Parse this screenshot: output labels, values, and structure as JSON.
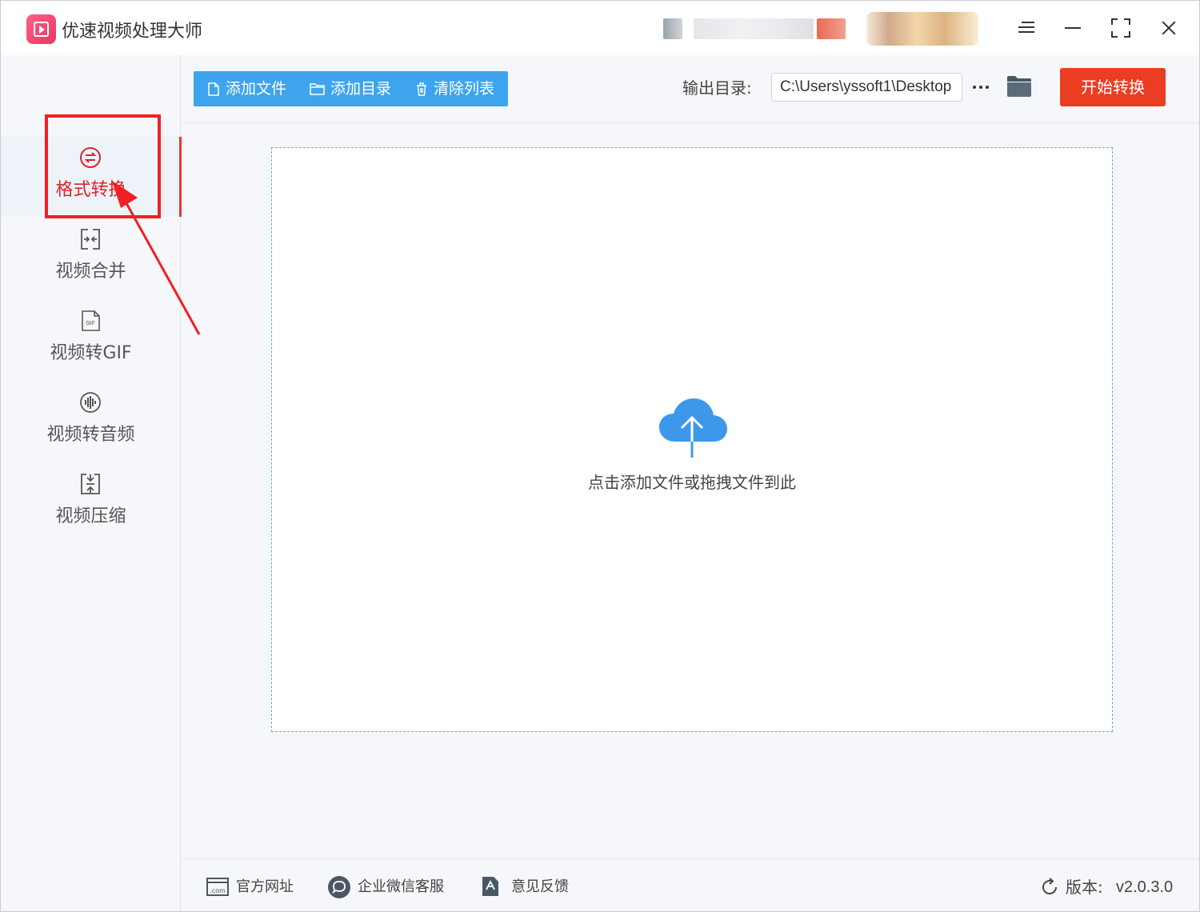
{
  "window": {
    "title": "优速视频处理大师"
  },
  "sidebar": {
    "items": [
      {
        "label": "格式转换",
        "icon": "format-convert-icon",
        "active": true
      },
      {
        "label": "视频合并",
        "icon": "video-merge-icon",
        "active": false
      },
      {
        "label": "视频转GIF",
        "icon": "gif-icon",
        "active": false
      },
      {
        "label": "视频转音频",
        "icon": "audio-icon",
        "active": false
      },
      {
        "label": "视频压缩",
        "icon": "compress-icon",
        "active": false
      }
    ]
  },
  "toolbar": {
    "add_file": "添加文件",
    "add_folder": "添加目录",
    "clear_list": "清除列表",
    "output_label": "输出目录:",
    "output_path": "C:\\Users\\yssoft1\\Desktop",
    "start": "开始转换"
  },
  "dropzone": {
    "hint": "点击添加文件或拖拽文件到此"
  },
  "footer": {
    "website": "官方网址",
    "wechat": "企业微信客服",
    "feedback": "意见反馈",
    "version_label": "版本:",
    "version_value": "v2.0.3.0"
  },
  "colors": {
    "accent_blue": "#3ea4ee",
    "start_button": "#ea3d22",
    "active_nav": "#d9262b",
    "highlight_annotation": "#f21f24"
  }
}
